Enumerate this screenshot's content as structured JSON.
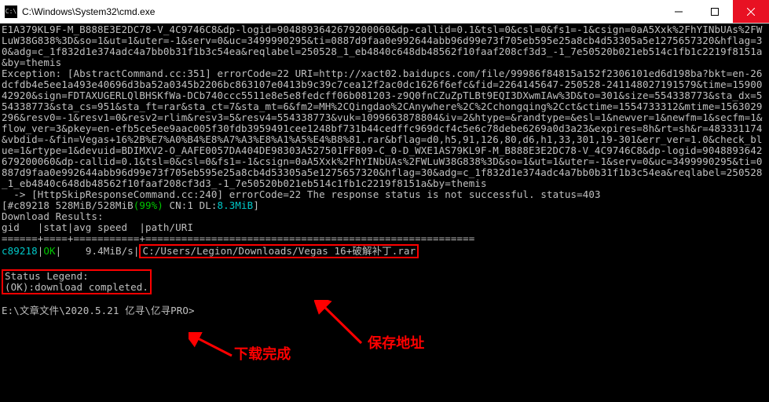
{
  "titlebar": {
    "title": "C:\\Windows\\System32\\cmd.exe"
  },
  "win_buttons": {
    "minimize": "minimize",
    "maximize": "maximize",
    "close": "close"
  },
  "terminal": {
    "dump1": "E1A379KL9F-M_B888E3E2DC78-V_4C9746C8&dp-logid=9048893642679200060&dp-callid=0.1&tsl=0&csl=0&fs1=-1&csign=0aA5Xxk%2FhYINbUAs%2FWLuW38G838%3D&so=1&ut=1&uter=-1&serv=0&uc=3499990295&ti=0887d9faa0e992644abb96d99e73f705eb595e25a8cb4d53305a5e1275657320&hflag=30&adg=c_1f832d1e374adc4a7bb0b31f1b3c54ea&reqlabel=250528_1_eb4840c648db48562f10faaf208cf3d3_-1_7e50520b021eb514c1fb1c2219f8151a&by=themis",
    "exception": "Exception: [AbstractCommand.cc:351] errorCode=22 URI=http://xact02.baidupcs.com/file/99986f84815a152f2306101ed6d198ba?bkt=en-26dcfdb4e5ee1a493e40696d3ba52a0345b2206bc863107e0413b9c39c7cea12f2ac0dc1626f6efc&fid=2264145647-250528-241148027191579&time=1590042920&sign=FDTAXUGERLQlBHSKfWa-DCb740ccc5511e8e5e8fedcff06b081203-z9Q0fnCZuZpTLBt9EQI3DXwmIAw%3D&to=301&size=554338773&sta_dx=554338773&sta_cs=951&sta_ft=rar&sta_ct=7&sta_mt=6&fm2=MH%2CQingdao%2CAnywhere%2C%2Cchongqing%2Cct&ctime=1554733312&mtime=1563029296&resv0=-1&resv1=0&resv2=rlim&resv3=5&resv4=554338773&vuk=1099663878804&iv=2&htype=&randtype=&esl=1&newver=1&newfm=1&secfm=1&flow_ver=3&pkey=en-efb5ce5ee9aac005f30fdb3959491cee1248bf731b44cedffc969dcf4c5e6c78debe6269a0d3a23&expires=8h&rt=sh&r=483331174&vbdid=-&fin=Vegas+16%2B%E7%A0%B4%E8%A7%A3%E8%A1%A5%E4%B8%81.rar&bflag=d0,h5,91,126,80,d6,h1,33,301,19-301&err_ver=1.0&check_blue=1&rtype=1&devuid=BDIMXV2-O_AAFE0057DA404DE98303A527501FF809-C_0-D_WXE1AS79KL9F-M_B888E3E2DC78-V_4C9746C8&dp-logid=9048893642679200060&dp-callid=0.1&tsl=0&csl=0&fs1=-1&csign=0aA5Xxk%2FhYINbUAs%2FWLuW38G838%3D&so=1&ut=1&uter=-1&serv=0&uc=3499990295&ti=0887d9faa0e992644abb96d99e73f705eb595e25a8cb4d53305a5e1275657320&hflag=30&adg=c_1f832d1e374adc4a7bb0b31f1b3c54ea&reqlabel=250528_1_eb4840c648db48562f10faaf208cf3d3_-1_7e50520b021eb514c1fb1c2219f8151a&by=themis",
    "skip_response": "  -> [HttpSkipResponseCommand.cc:240] errorCode=22 The response status is not successful. status=403",
    "progress_prefix": "[#c89218 528MiB/528MiB",
    "progress_pct": "(99%)",
    "progress_cn": " CN:1 DL:",
    "progress_dl": "8.3MiB",
    "progress_suffix": "]",
    "dlresults": "Download Results:",
    "header": "gid   |stat|avg speed  |path/URI",
    "divider": "======+====+===========+=======================================================",
    "row_gid": "c89218",
    "row_stat": "OK",
    "row_sep1": "| ",
    "row_speed": "   9.4MiB/s",
    "row_sep2": "|",
    "row_path": "C:/Users/Legion/Downloads/Vegas 16+破解补丁.rar",
    "legend1": "Status Legend:",
    "legend2": "(OK):download completed.",
    "prompt": "E:\\文章文件\\2020.5.21 亿寻\\亿寻PRO>"
  },
  "annotations": {
    "download_complete": "下载完成",
    "save_path": "保存地址"
  }
}
